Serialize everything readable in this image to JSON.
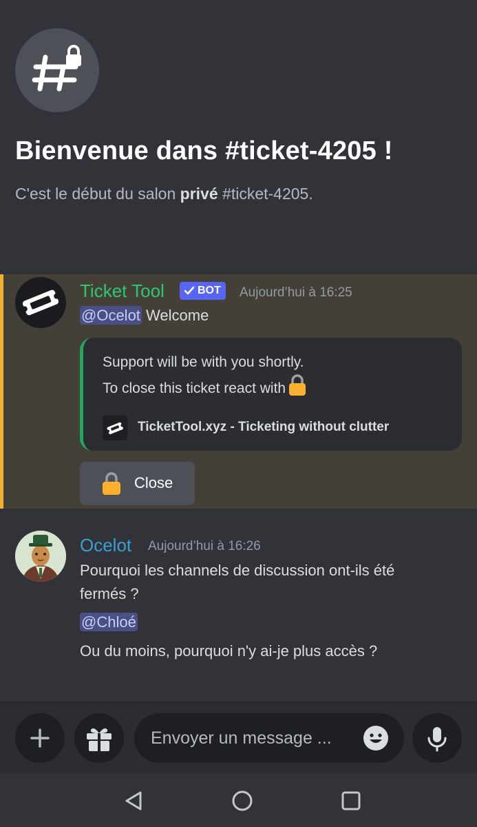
{
  "welcome": {
    "title": "Bienvenue dans #ticket-4205 !",
    "subtitle_prefix": "C'est le début du salon ",
    "subtitle_bold": "privé",
    "subtitle_suffix": " #ticket-4205."
  },
  "messages": [
    {
      "author": "Ticket Tool",
      "badge": "BOT",
      "timestamp": "Aujourd’hui à 16:25",
      "mention": "@Ocelot",
      "text": " Welcome",
      "embed": {
        "line1": "Support will be with you shortly.",
        "line2": "To close this ticket react with",
        "footer": "TicketTool.xyz - Ticketing without clutter"
      },
      "button_label": "Close"
    },
    {
      "author": "Ocelot",
      "timestamp": "Aujourd’hui à 16:26",
      "line1": "Pourquoi les channels de discussion ont-ils été",
      "line2": "fermés ?",
      "mention": "@Chloé",
      "line3": "Ou du moins, pourquoi n'y ai-je plus accès ?"
    }
  ],
  "composer": {
    "placeholder": "Envoyer un message ..."
  },
  "icons": {
    "channel": "locked-hashtag-icon",
    "add": "plus-icon",
    "gift": "gift-icon",
    "emoji": "emoji-icon",
    "mic": "microphone-icon",
    "nav_back": "back-triangle-icon",
    "nav_home": "home-circle-icon",
    "nav_recents": "recents-square-icon"
  },
  "colors": {
    "background": "#313338",
    "mention_highlight": "#444037",
    "mention_border": "#f0b232",
    "bot_name": "#2dc770",
    "user_name": "#3b9fd6",
    "bot_badge": "#5865f2",
    "embed_border": "#23a55a"
  }
}
